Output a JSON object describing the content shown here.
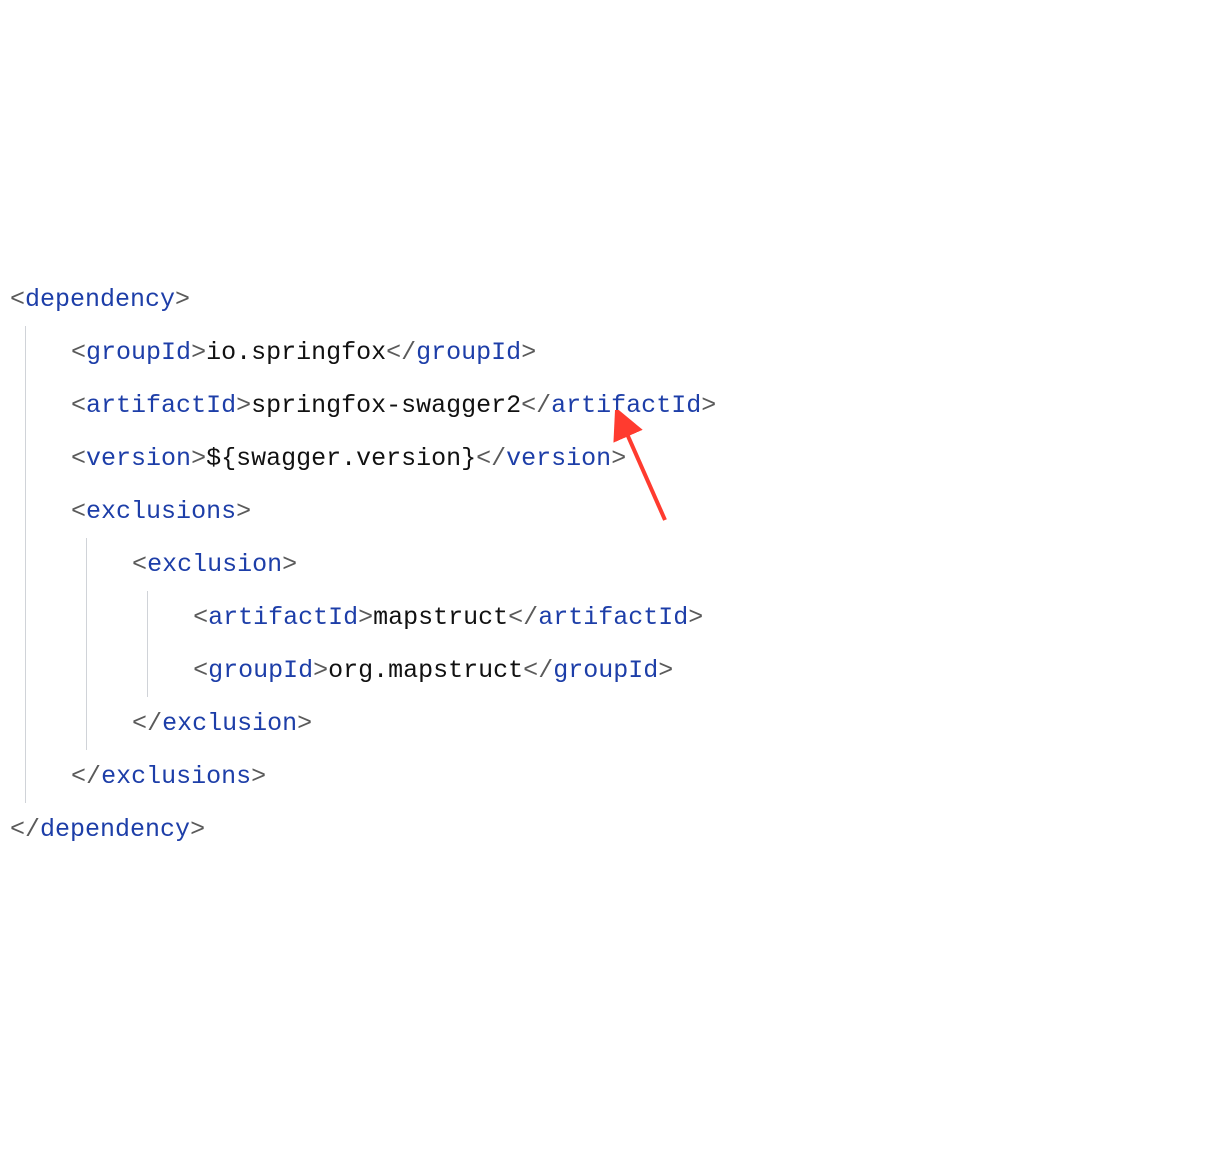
{
  "code": {
    "p_lt": "<",
    "p_gt": ">",
    "p_sl": "/",
    "tag_dependency": "dependency",
    "tag_groupId": "groupId",
    "tag_artifactId": "artifactId",
    "tag_version": "version",
    "tag_exclusions": "exclusions",
    "tag_exclusion": "exclusion",
    "val_groupId": "io.springfox",
    "val_artifactId": "springfox-swagger2",
    "val_version": "${swagger.version}",
    "val_excl_artifactId": "mapstruct",
    "val_excl_groupId": "org.mapstruct"
  },
  "arrow": {
    "color": "#ff3b2f"
  }
}
